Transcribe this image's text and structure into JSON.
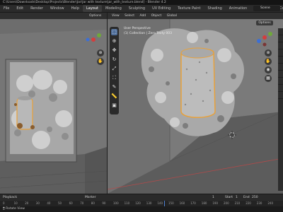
{
  "window": {
    "title": "C:\\Users\\Downloads\\Desktop\\Projects\\Blender\\Jar\\Jar with texture\\jar_with_texture.blend] - Blender 4.2"
  },
  "workspaces": [
    "File",
    "Edit",
    "Render",
    "Window",
    "Help",
    "Layout",
    "Modeling",
    "Sculpting",
    "UV Editing",
    "Texture Paint",
    "Shading",
    "Animation",
    "Rendering",
    "Compositing",
    "Geometry Nodes",
    "Scripting"
  ],
  "workspace_active": "Layout",
  "scene": {
    "label": "Scene"
  },
  "left_view": {
    "options": "Options"
  },
  "right_view": {
    "header": [
      "View",
      "Select",
      "Add",
      "Object",
      "Global"
    ],
    "options": "Options",
    "overlay_line1": "User Perspective",
    "overlay_line2": "(1) Collection | Zero Texty 003"
  },
  "toolbar": {
    "tools": [
      {
        "icon": "select-box-icon",
        "glyph": "⬚",
        "active": true
      },
      {
        "icon": "cursor-icon",
        "glyph": "⊕",
        "active": false
      },
      {
        "icon": "move-icon",
        "glyph": "✥",
        "active": false
      },
      {
        "icon": "rotate-icon",
        "glyph": "↻",
        "active": false
      },
      {
        "icon": "scale-icon",
        "glyph": "⤢",
        "active": false
      },
      {
        "icon": "transform-icon",
        "glyph": "⛶",
        "active": false
      },
      {
        "icon": "annotate-icon",
        "glyph": "✎",
        "active": false
      },
      {
        "icon": "measure-icon",
        "glyph": "📏",
        "active": false
      },
      {
        "icon": "add-cube-icon",
        "glyph": "▣",
        "active": false
      }
    ]
  },
  "timeline": {
    "mode": "Playback",
    "marker": "Marker",
    "start_label": "Start",
    "start_value": "1",
    "end_label": "End",
    "end_value": "250",
    "current_frame": "1"
  },
  "ruler": {
    "ticks": [
      "0",
      "10",
      "20",
      "30",
      "40",
      "50",
      "60",
      "70",
      "80",
      "90",
      "100",
      "110",
      "120",
      "130",
      "140",
      "150",
      "160",
      "170",
      "180",
      "190",
      "200",
      "210",
      "220",
      "230",
      "240"
    ]
  },
  "status": {
    "text": "Rotate View"
  },
  "colors": {
    "accent": "#4f6e9a",
    "selection_outline": "#e8a13a",
    "axis_x": "#d43d3d",
    "axis_y": "#6fa83a",
    "axis_z": "#3d6fd4"
  }
}
